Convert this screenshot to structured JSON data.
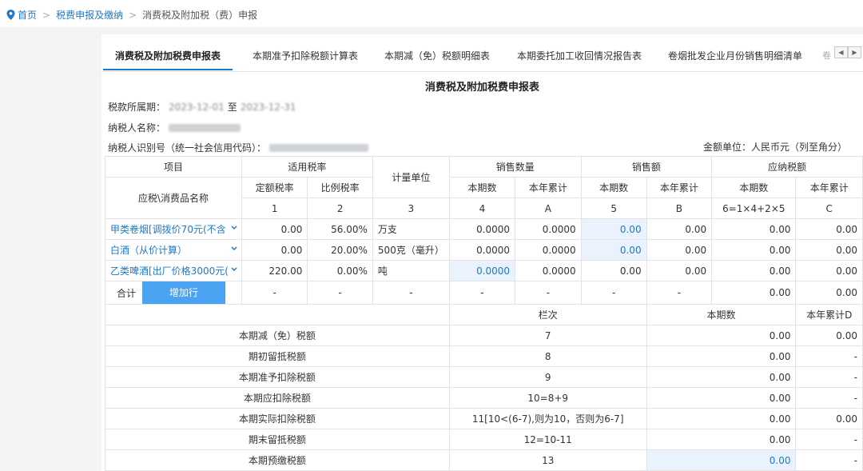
{
  "breadcrumb": {
    "home": "首页",
    "section": "税费申报及缴纳",
    "current": "消费税及附加税（费）申报"
  },
  "tabs": [
    "消费税及附加税费申报表",
    "本期准予扣除税额计算表",
    "本期减（免）税额明细表",
    "本期委托加工收回情况报告表",
    "卷烟批发企业月份销售明细清单"
  ],
  "form": {
    "title": "消费税及附加税费申报表",
    "period_label": "税款所属期：",
    "period_start": "2023-12-01",
    "period_to": "至",
    "period_end": "2023-12-31",
    "taxpayer_name_label": "纳税人名称：",
    "taxpayer_id_label": "纳税人识别号（统一社会信用代码）：",
    "unit": "金额单位：人民币元（列至角分）"
  },
  "table": {
    "h_item": "项目",
    "h_rate": "适用税率",
    "h_unit": "计量单位",
    "h_qty": "销售数量",
    "h_sales": "销售额",
    "h_tax": "应纳税额",
    "h_name": "应税\\消费品名称",
    "h_fixed": "定额税率",
    "h_ratio": "比例税率",
    "h_current": "本期数",
    "h_ytd": "本年累计",
    "col_numbers": [
      "1",
      "2",
      "3",
      "4",
      "A",
      "5",
      "B",
      "6=1×4+2×5",
      "C"
    ],
    "rows": [
      {
        "name": "甲类卷烟[调拨价70元(不含",
        "fixed": "0.00",
        "ratio": "56.00%",
        "unit": "万支",
        "qty": "0.0000",
        "qty_ytd": "0.0000",
        "sales": "0.00",
        "sales_ytd": "0.00",
        "tax": "0.00",
        "tax_ytd": "0.00"
      },
      {
        "name": "白酒（从价计算）",
        "fixed": "0.00",
        "ratio": "20.00%",
        "unit": "500克（毫升）",
        "qty": "0.0000",
        "qty_ytd": "0.0000",
        "sales": "0.00",
        "sales_ytd": "0.00",
        "tax": "0.00",
        "tax_ytd": "0.00"
      },
      {
        "name": "乙类啤酒[出厂价格3000元(",
        "fixed": "220.00",
        "ratio": "0.00%",
        "unit": "吨",
        "qty": "0.0000",
        "qty_ytd": "0.0000",
        "sales": "0.00",
        "sales_ytd": "0.00",
        "tax": "0.00",
        "tax_ytd": "0.00"
      }
    ],
    "total": {
      "label": "合计",
      "add_button": "增加行",
      "dash": "-",
      "tax": "0.00",
      "tax_ytd": "0.00"
    },
    "h_column": "栏次",
    "h_period": "本期数",
    "h_ytd_d": "本年累计D",
    "detail": [
      {
        "label": "本期减（免）税额",
        "col": "7",
        "current": "0.00",
        "ytd": "0.00"
      },
      {
        "label": "期初留抵税额",
        "col": "8",
        "current": "0.00",
        "ytd": "-"
      },
      {
        "label": "本期准予扣除税额",
        "col": "9",
        "current": "0.00",
        "ytd": "-"
      },
      {
        "label": "本期应扣除税额",
        "col": "10=8+9",
        "current": "0.00",
        "ytd": "-"
      },
      {
        "label": "本期实际扣除税额",
        "col": "11[10<(6-7),则为10，否则为6-7]",
        "current": "0.00",
        "ytd": "0.00"
      },
      {
        "label": "期末留抵税额",
        "col": "12=10-11",
        "current": "0.00",
        "ytd": "-"
      },
      {
        "label": "本期预缴税额",
        "col": "13",
        "current": "0.00",
        "ytd": "-"
      }
    ]
  },
  "colors": {
    "accent": "#1e78c8",
    "button": "#4aa3f0",
    "highlight": "#eaf3fd"
  }
}
